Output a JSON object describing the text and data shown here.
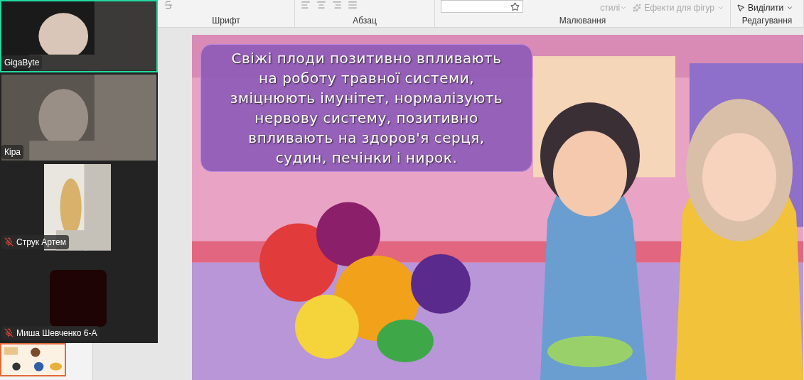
{
  "ribbon": {
    "groups": [
      {
        "label": "Шрифт"
      },
      {
        "label": "Абзац"
      },
      {
        "label": "Малювання"
      },
      {
        "label": "Редагування"
      }
    ],
    "commands": [
      {
        "label": "стилі",
        "disabled": true
      },
      {
        "label": "Ефекти для фігур",
        "disabled": true
      },
      {
        "label": "Виділити",
        "disabled": false
      }
    ]
  },
  "participants": [
    {
      "name": "GigaByte",
      "muted": false,
      "speaking": true,
      "video": true
    },
    {
      "name": "Кіра",
      "muted": false,
      "speaking": false,
      "video": true
    },
    {
      "name": "Струк Артем",
      "muted": true,
      "speaking": false,
      "video": true
    },
    {
      "name": "Миша Шевченко 6-А",
      "muted": true,
      "speaking": false,
      "video": false
    }
  ],
  "thumbnails": [
    {
      "kind": "picture",
      "selected": true
    }
  ],
  "slide": {
    "text": "Свіжі плоди позитивно впливають на роботу травної системи, зміцнюють імунітет, нормалізують нервову систему, позитивно впливають на здоров'я серця, судин, печінки і нирок."
  }
}
